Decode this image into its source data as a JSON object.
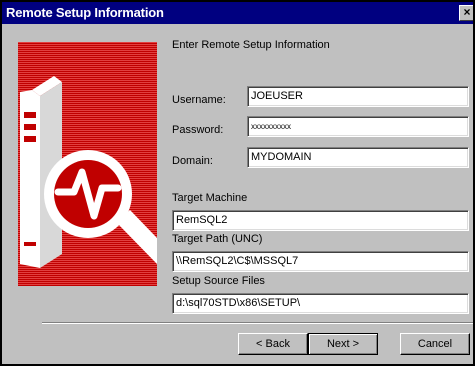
{
  "window": {
    "title": "Remote Setup Information",
    "close_glyph": "×"
  },
  "heading": "Enter Remote Setup Information",
  "fields": {
    "username": {
      "label": "Username:",
      "value": "JOEUSER"
    },
    "password": {
      "label": "Password:",
      "value": "xxxxxxxxxx"
    },
    "domain": {
      "label": "Domain:",
      "value": "MYDOMAIN"
    },
    "target_machine": {
      "label": "Target Machine",
      "value": "RemSQL2"
    },
    "target_path": {
      "label": "Target Path (UNC)",
      "value": "\\\\RemSQL2\\C$\\MSSQL7"
    },
    "setup_source": {
      "label": "Setup Source Files",
      "value": "d:\\sql70STD\\x86\\SETUP\\"
    }
  },
  "buttons": {
    "back": "< Back",
    "next": "Next >",
    "cancel": "Cancel"
  },
  "icons": {
    "banner": "server-magnifier-icon"
  },
  "colors": {
    "titlebar": "#000080",
    "banner": "#c00000"
  }
}
